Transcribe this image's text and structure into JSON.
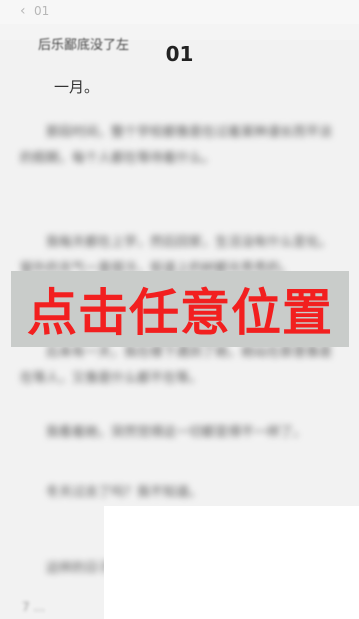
{
  "nav": {
    "back_icon": "chevron-left-icon",
    "chapter_number": "01"
  },
  "reader": {
    "peek_text": "后乐鄙底没了左",
    "chapter_title": "01",
    "first_line": "一月。",
    "blurred_paragraphs": [
      "那段时间，整个学校都像是在过着某种漫长而平淡的假期，每个人都在等待着什么。",
      "我每天都在上学，然后回家，生活没有什么变化。窗外的天气一直很冷，街道上的树都光秃秃的。",
      "后来有一天，我在楼下遇到了她，她站在那里像是在等人，又像是什么都不在等。",
      "我看着她，突然觉得这一切都变得不一样了。",
      "冬天过去了吗？我不知道。",
      "这样的日子还在继续"
    ],
    "tiny_text": "7 ...",
    "overlay_text": "点击任意位置"
  },
  "colors": {
    "overlay_text": "#f21f1f",
    "overlay_band": "#c9ccca"
  }
}
